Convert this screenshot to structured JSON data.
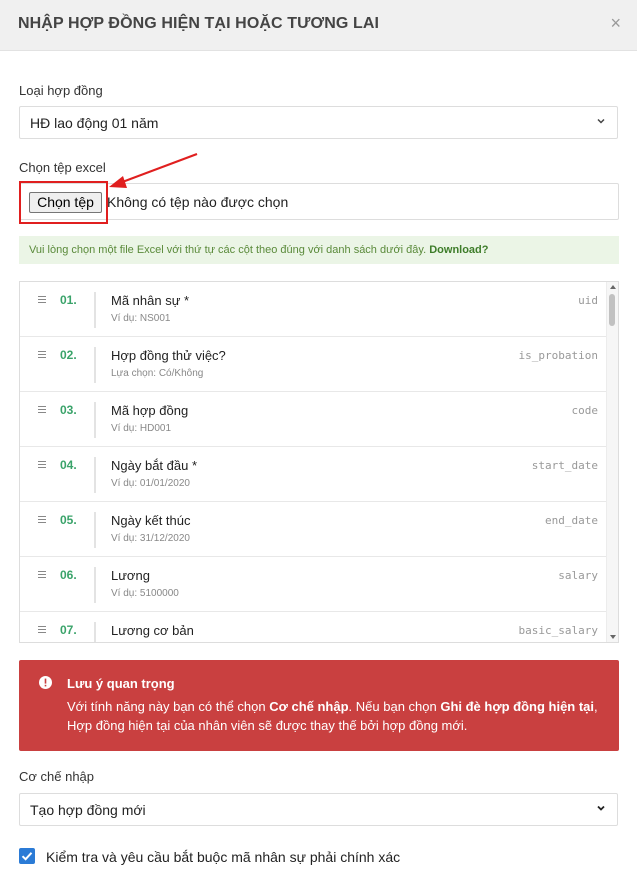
{
  "modal": {
    "title": "NHẬP HỢP ĐỒNG HIỆN TẠI HOẶC TƯƠNG LAI",
    "close_symbol": "×"
  },
  "contract_type": {
    "label": "Loại hợp đồng",
    "value": "HĐ lao động 01 năm"
  },
  "file": {
    "label": "Chọn tệp excel",
    "button_label": "Chọn tệp",
    "status": "Không có tệp nào được chọn"
  },
  "info": {
    "text": "Vui lòng chọn một file Excel với thứ tự các cột theo đúng với danh sách dưới đây. ",
    "link": "Download?"
  },
  "columns": [
    {
      "num": "01.",
      "name": "Mã nhân sự *",
      "hint": "Ví dụ: NS001",
      "key": "uid"
    },
    {
      "num": "02.",
      "name": "Hợp đồng thử việc?",
      "hint": "Lựa chọn: Có/Không",
      "key": "is_probation"
    },
    {
      "num": "03.",
      "name": "Mã hợp đồng",
      "hint": "Ví dụ: HD001",
      "key": "code"
    },
    {
      "num": "04.",
      "name": "Ngày bắt đầu *",
      "hint": "Ví dụ: 01/01/2020",
      "key": "start_date"
    },
    {
      "num": "05.",
      "name": "Ngày kết thúc",
      "hint": "Ví dụ: 31/12/2020",
      "key": "end_date"
    },
    {
      "num": "06.",
      "name": "Lương",
      "hint": "Ví dụ: 5100000",
      "key": "salary"
    },
    {
      "num": "07.",
      "name": "Lương cơ bản",
      "hint": "",
      "key": "basic_salary"
    }
  ],
  "warning": {
    "title": "Lưu ý quan trọng",
    "part1": "Với tính năng này bạn có thể chọn ",
    "bold1": "Cơ chế nhập",
    "part2": ". Nếu bạn chọn ",
    "bold2": "Ghi đè hợp đồng hiện tại",
    "part3": ", Hợp đồng hiện tại của nhân viên sẽ được thay thế bởi hợp đồng mới."
  },
  "import_mode": {
    "label": "Cơ chế nhập",
    "value": "Tạo hợp đồng mới"
  },
  "validate": {
    "label": "Kiểm tra và yêu cầu bắt buộc mã nhân sự phải chính xác",
    "checked": true
  },
  "colors": {
    "accent_green": "#3aa36a",
    "danger_red": "#c94040",
    "highlight_red": "#e01f1f",
    "checkbox_blue": "#2b7bd6"
  }
}
